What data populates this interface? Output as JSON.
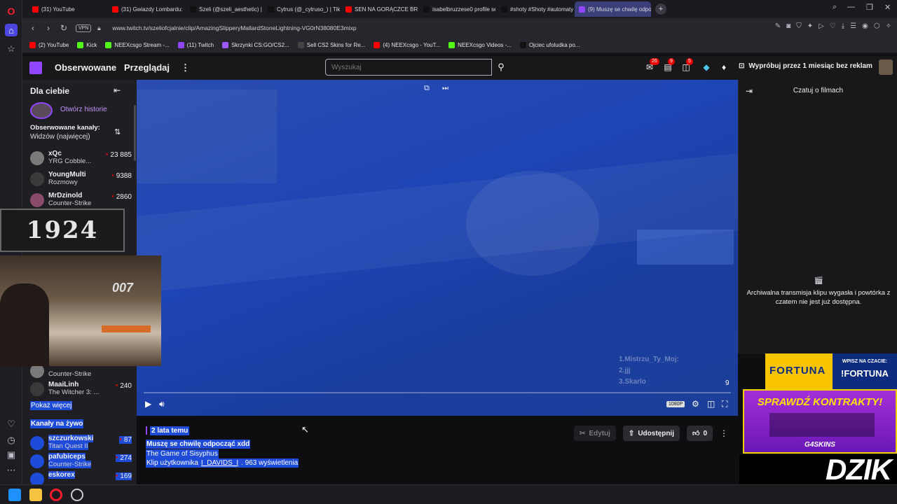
{
  "browser": {
    "tabs": [
      {
        "label": "(31) YouTube",
        "color": "#ff0000"
      },
      {
        "label": "(31) Gwiazdy Lombardu: C",
        "color": "#ff0000"
      },
      {
        "label": "Szeli (@szeli_aesthetic) | T",
        "color": "#111111"
      },
      {
        "label": "Cytrus (@_cytruso_) | TikTo",
        "color": "#111111"
      },
      {
        "label": "SEN NA GORĄCZCE BRAC",
        "color": "#ff0000"
      },
      {
        "label": "isabelbruzzese0 profile se",
        "color": "#111111"
      },
      {
        "label": "#shoty #Shoty #automaty",
        "color": "#111111"
      },
      {
        "label": "(9) Muszę se chwilę odpo",
        "color": "#9147ff",
        "active": true
      }
    ],
    "new_tab": "+",
    "url": "www.twitch.tv/szeliofcjalnie/clip/AmazingSlipperyMallardStoneLightning-VG0rN38080E3mixp",
    "vpn_label": "VPN",
    "bookmarks": [
      {
        "label": "(2) YouTube",
        "color": "#ff0000"
      },
      {
        "label": "Kick",
        "color": "#53fc18"
      },
      {
        "label": "NEEXcsgo Stream -...",
        "color": "#53fc18"
      },
      {
        "label": "(11) Twitch",
        "color": "#9147ff"
      },
      {
        "label": "Skrzynki CS:GO/CS2...",
        "color": "#9b59ff"
      },
      {
        "label": "Sell CS2 Skins for Re...",
        "color": "#444444"
      },
      {
        "label": "(4) NEEXcsgo - YouT...",
        "color": "#ff0000"
      },
      {
        "label": "NEEXcsgo Videos -...",
        "color": "#53fc18"
      },
      {
        "label": "Ojciec ufoludka po...",
        "color": "#111111"
      }
    ]
  },
  "twitch": {
    "nav": {
      "followed": "Obserwowane",
      "browse": "Przeglądaj",
      "more": "⋮",
      "search_placeholder": "Wyszukaj",
      "badges": [
        "26",
        "9",
        "5"
      ],
      "prime_label": "Wypróbuj przez 1 miesiąc bez reklam"
    },
    "sidebar": {
      "title": "Dla ciebie",
      "story_label": "Otwórz historie",
      "followed_header": "Obserwowane kanały:",
      "followed_sort": "Widzów (najwięcej)",
      "channels": [
        {
          "name": "xQc",
          "game": "YRG Cobble...",
          "viewers": "23 885"
        },
        {
          "name": "YoungMulti",
          "game": "Rozmowy",
          "viewers": "9388"
        },
        {
          "name": "MrDzinold",
          "game": "Counter-Strike",
          "viewers": "2860"
        }
      ],
      "more_channels": [
        {
          "name": "",
          "game": "Counter-Strike",
          "viewers": ""
        },
        {
          "name": "MaaiLinh",
          "game": "The Witcher 3: ...",
          "viewers": "240"
        }
      ],
      "show_more": "Pokaż więcej",
      "live_header": "Kanały na żywo",
      "live": [
        {
          "name": "szczurkowski",
          "game": "Titan Quest II",
          "viewers": "87"
        },
        {
          "name": "pafubiceps",
          "game": "Counter-Strike",
          "viewers": "274"
        },
        {
          "name": "eskorex",
          "game": "",
          "viewers": "169"
        }
      ]
    },
    "overlay_year": "1924",
    "webcam_brand": "007",
    "video": {
      "counter": "9",
      "quality": "1080P",
      "scores": [
        "1.Mistrzu_Ty_Moj:",
        "2.jjj",
        "3.Skarlo"
      ]
    },
    "chat": {
      "title": "Czatuj o filmach",
      "message": "Archiwalna transmisja klipu wygasła i powtórka z czatem nie jest już dostępna."
    },
    "clip": {
      "age": "2 lata temu",
      "title": "Muszę se chwilę odpocząć xdd",
      "game": "The Game of Sisyphus",
      "meta_prefix": "Klip użytkownika",
      "author": "I_DAVIDS_I",
      "meta_suffix": ". 963 wyświetlenia",
      "edit_label": "Edytuj",
      "share_label": "Udostępnij",
      "likes": "0"
    }
  },
  "ads": {
    "fortuna_brand": "FORTUNA",
    "fortuna_cta_small": "WPISZ NA CZACIE:",
    "fortuna_cta": "!FORTUNA",
    "g4_title": "SPRAWDŹ KONTRAKTY!",
    "g4_brand": "G4SKINS",
    "dzik_brand": "DZIK"
  }
}
